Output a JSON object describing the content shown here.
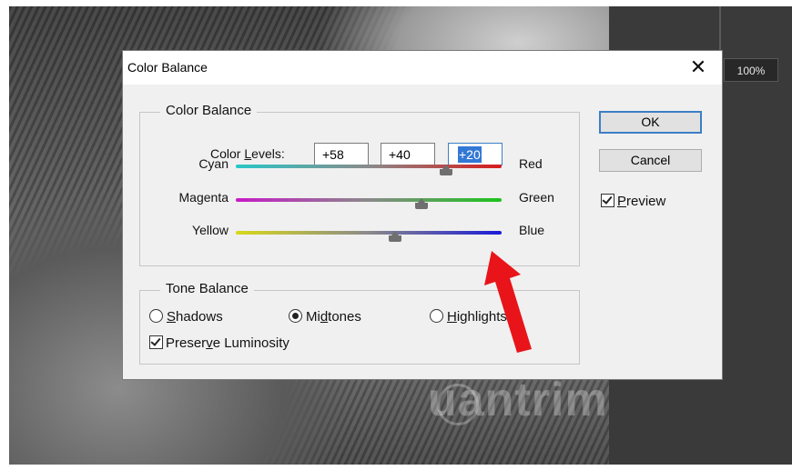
{
  "background": {
    "zoom": "100%",
    "watermark": "uantrimang"
  },
  "dialog": {
    "title": "Color Balance",
    "close_glyph": "✕",
    "color_balance": {
      "group_label": "Color Balance",
      "levels_label_pre": "Color ",
      "levels_label_u": "L",
      "levels_label_post": "evels:",
      "levels": [
        "+58",
        "+40",
        "+20"
      ],
      "sliders": [
        {
          "left": "Cyan",
          "right": "Red",
          "value": 58,
          "colors": [
            "#27c7c7",
            "#d81b1b"
          ]
        },
        {
          "left": "Magenta",
          "right": "Green",
          "value": 40,
          "colors": [
            "#c61bc6",
            "#1bc41b"
          ]
        },
        {
          "left": "Yellow",
          "right": "Blue",
          "value": 20,
          "colors": [
            "#d8d81b",
            "#1b1bd8"
          ]
        }
      ]
    },
    "tone_balance": {
      "group_label": "Tone Balance",
      "options": [
        {
          "u": "S",
          "rest": "hadows",
          "selected": false
        },
        {
          "pre": "Mi",
          "u": "d",
          "rest": "tones",
          "selected": true
        },
        {
          "u": "H",
          "rest": "ighlights",
          "selected": false
        }
      ],
      "preserve": {
        "pre": "Preser",
        "u": "v",
        "rest": "e Luminosity",
        "checked": true
      }
    },
    "buttons": {
      "ok": "OK",
      "cancel": "Cancel"
    },
    "preview": {
      "u": "P",
      "rest": "review",
      "checked": true
    }
  },
  "annotation": {
    "arrow_color": "#e8141a"
  }
}
